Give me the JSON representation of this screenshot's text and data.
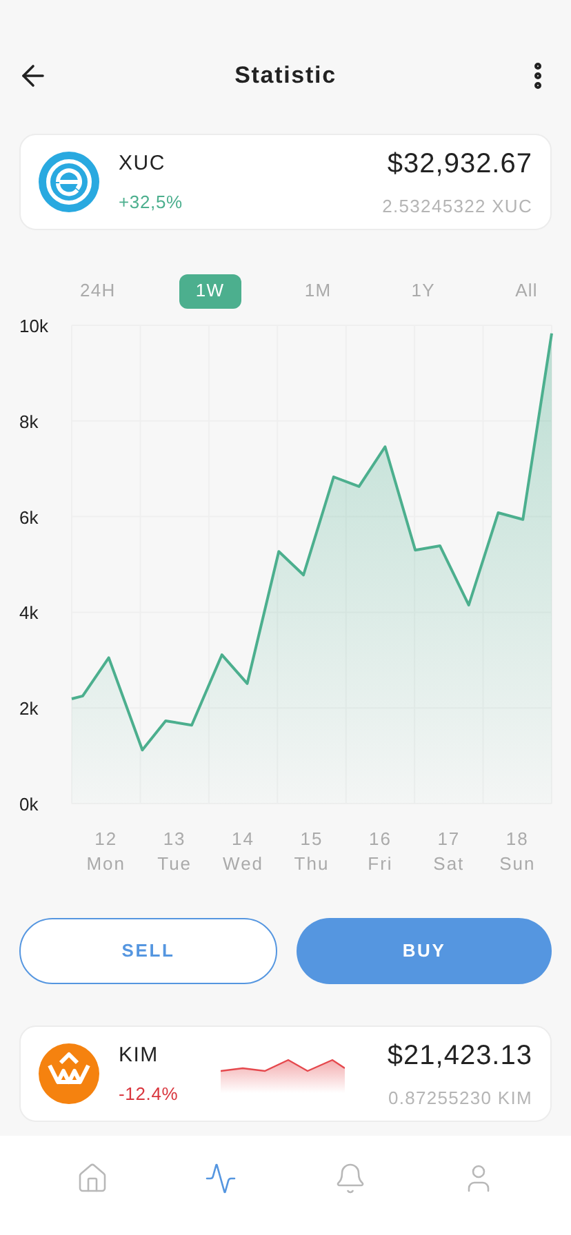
{
  "header": {
    "title": "Statistic"
  },
  "coins": [
    {
      "kind": "main",
      "symbol": "XUC",
      "change": "+32,5%",
      "color": "#4caf8e",
      "price": "$32,932.67",
      "holding": "2.53245322 XUC"
    },
    {
      "kind": "sparkline",
      "symbol": "KIM",
      "change": "-12.4%",
      "color": "#d9363e",
      "price": "$21,423.13",
      "holding": "0.87255230 KIM"
    }
  ],
  "ranges": [
    {
      "label": "24H",
      "selected": false
    },
    {
      "label": "1W",
      "selected": true
    },
    {
      "label": "1M",
      "selected": false
    },
    {
      "label": "1Y",
      "selected": false
    },
    {
      "label": "All",
      "selected": false
    }
  ],
  "chart_data": {
    "type": "area",
    "x": [
      11.5,
      11.66,
      12.04,
      12.53,
      12.87,
      13.25,
      13.69,
      14.06,
      14.52,
      14.88,
      15.32,
      15.69,
      16.07,
      16.51,
      16.87,
      17.29,
      17.72,
      18.08,
      18.5
    ],
    "series": [
      {
        "color": "#4caf8e",
        "values": [
          2190,
          2250,
          3050,
          1120,
          1730,
          1640,
          3110,
          2510,
          5270,
          4780,
          6830,
          6630,
          7460,
          5300,
          5390,
          4150,
          6080,
          5940,
          9830
        ]
      }
    ],
    "grid": true,
    "xlim": [
      11.5,
      18.5
    ],
    "ylim": [
      0,
      10000
    ],
    "xticks": [
      {
        "value": 12,
        "label": "12 Mon"
      },
      {
        "value": 13,
        "label": "13 Tue"
      },
      {
        "value": 14,
        "label": "14 Wed"
      },
      {
        "value": 15,
        "label": "15 Thu"
      },
      {
        "value": 16,
        "label": "16 Fri"
      },
      {
        "value": 17,
        "label": "17 Sat"
      },
      {
        "value": 18,
        "label": "18 Sun"
      }
    ],
    "yticks": [
      {
        "value": 0,
        "label": "0k"
      },
      {
        "value": 2000,
        "label": "2k"
      },
      {
        "value": 4000,
        "label": "4k"
      },
      {
        "value": 6000,
        "label": "6k"
      },
      {
        "value": 8000,
        "label": "8k"
      },
      {
        "value": 10000,
        "label": "10k"
      }
    ]
  },
  "actions": [
    {
      "label": "SELL",
      "kind": "outline"
    },
    {
      "label": "BUY",
      "kind": "filled"
    }
  ],
  "nav": [
    {
      "kind": "home",
      "selected": false
    },
    {
      "kind": "activity",
      "selected": true
    },
    {
      "kind": "bell",
      "selected": false
    },
    {
      "kind": "user",
      "selected": false
    }
  ]
}
